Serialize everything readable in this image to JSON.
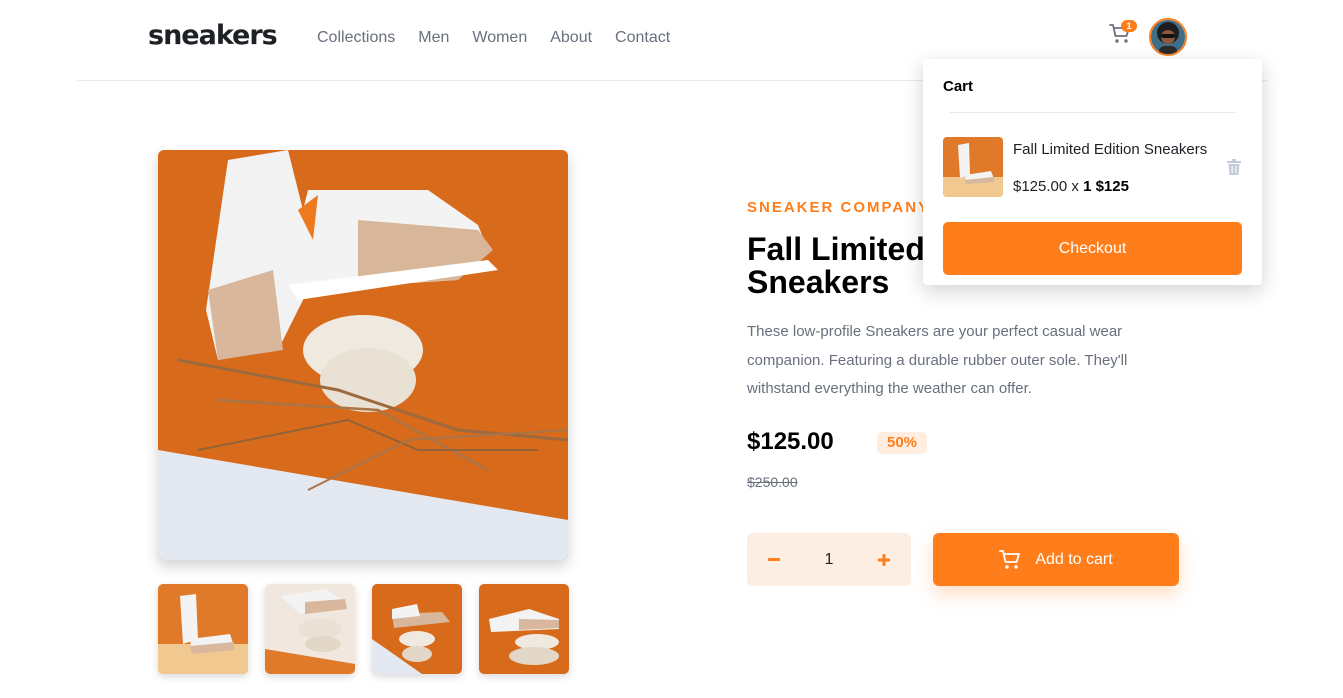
{
  "brand": {
    "logo": "sneakers"
  },
  "nav": {
    "items": [
      "Collections",
      "Men",
      "Women",
      "About",
      "Contact"
    ]
  },
  "header": {
    "cart_count": "1",
    "cart_icon": "cart-icon",
    "avatar_icon": "user-avatar"
  },
  "product": {
    "company": "SNEAKER COMPANY",
    "title": "Fall Limited Edition Sneakers",
    "title_visible": "Fall Limited\nSneakers",
    "description": "These low-profile Sneakers are your perfect casual wear companion. Featuring a durable rubber outer sole. They'll withstand everything the weather can offer.",
    "price": "$125.00",
    "discount": "50%",
    "old_price": "$250.00",
    "quantity": "1",
    "add_to_cart": "Add to cart"
  },
  "cart": {
    "title": "Cart",
    "item_name": "Fall Limited Edition Sneakers",
    "item_price_line": "$125.00 x ",
    "item_qty_total": "1 $125",
    "checkout_label": "Checkout"
  },
  "colors": {
    "accent": "#ff7e1b",
    "accent_pale": "#ffede0",
    "text_dark": "#1d2025",
    "text_muted": "#69707d"
  }
}
